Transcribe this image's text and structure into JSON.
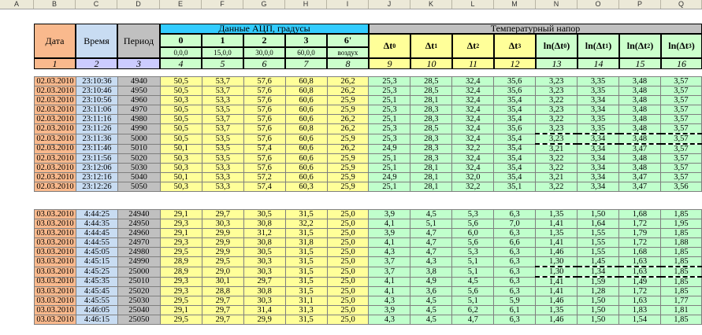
{
  "columns": [
    "A",
    "B",
    "C",
    "D",
    "E",
    "F",
    "G",
    "H",
    "I",
    "J",
    "K",
    "L",
    "M",
    "N",
    "O",
    "P",
    "Q"
  ],
  "header": {
    "date": "Дата",
    "time": "Время",
    "period": "Период",
    "adc_title": "Данные АЦП, градусы",
    "adc_channels": [
      "0",
      "1",
      "2",
      "3",
      "6'"
    ],
    "adc_positions": [
      "0,0,0",
      "15,0,0",
      "30,0,0",
      "60,0,0",
      "воздух"
    ],
    "temp_title": "Температурный напор",
    "dt_labels": [
      [
        "Δt",
        "0"
      ],
      [
        "Δt",
        "1"
      ],
      [
        "Δt",
        "2"
      ],
      [
        "Δt",
        "3"
      ]
    ],
    "ln_labels": [
      [
        "ln(Δt",
        "0",
        ")"
      ],
      [
        "ln(Δt",
        "1",
        ")"
      ],
      [
        "ln(Δt",
        "2",
        ")"
      ],
      [
        "ln(Δt",
        "3",
        ")"
      ]
    ],
    "index_row": [
      "1",
      "2",
      "3",
      "4",
      "5",
      "6",
      "7",
      "8",
      "9",
      "10",
      "11",
      "12",
      "13",
      "14",
      "15",
      "16"
    ]
  },
  "block1": [
    [
      "02.03.2010",
      "23:10:36",
      "4940",
      "50,5",
      "53,7",
      "57,6",
      "60,8",
      "26,2",
      "25,3",
      "28,5",
      "32,4",
      "35,6",
      "3,23",
      "3,35",
      "3,48",
      "3,57"
    ],
    [
      "02.03.2010",
      "23:10:46",
      "4950",
      "50,5",
      "53,7",
      "57,6",
      "60,8",
      "26,2",
      "25,3",
      "28,5",
      "32,4",
      "35,6",
      "3,23",
      "3,35",
      "3,48",
      "3,57"
    ],
    [
      "02.03.2010",
      "23:10:56",
      "4960",
      "50,3",
      "53,3",
      "57,6",
      "60,6",
      "25,9",
      "25,1",
      "28,1",
      "32,4",
      "35,4",
      "3,22",
      "3,34",
      "3,48",
      "3,57"
    ],
    [
      "02.03.2010",
      "23:11:06",
      "4970",
      "50,5",
      "53,5",
      "57,6",
      "60,6",
      "25,9",
      "25,3",
      "28,3",
      "32,4",
      "35,4",
      "3,23",
      "3,34",
      "3,48",
      "3,57"
    ],
    [
      "02.03.2010",
      "23:11:16",
      "4980",
      "50,5",
      "53,7",
      "57,6",
      "60,6",
      "26,2",
      "25,1",
      "28,3",
      "32,4",
      "35,4",
      "3,22",
      "3,35",
      "3,48",
      "3,57"
    ],
    [
      "02.03.2010",
      "23:11:26",
      "4990",
      "50,5",
      "53,7",
      "57,6",
      "60,8",
      "26,2",
      "25,3",
      "28,5",
      "32,4",
      "35,6",
      "3,23",
      "3,35",
      "3,48",
      "3,57"
    ],
    [
      "02.03.2010",
      "23:11:36",
      "5000",
      "50,5",
      "53,5",
      "57,6",
      "60,6",
      "25,9",
      "25,3",
      "28,3",
      "32,4",
      "35,4",
      "3,23",
      "3,34",
      "3,48",
      "3,57"
    ],
    [
      "02.03.2010",
      "23:11:46",
      "5010",
      "50,1",
      "53,5",
      "57,4",
      "60,6",
      "26,2",
      "24,9",
      "28,3",
      "32,2",
      "35,4",
      "3,21",
      "3,34",
      "3,47",
      "3,57"
    ],
    [
      "02.03.2010",
      "23:11:56",
      "5020",
      "50,3",
      "53,5",
      "57,6",
      "60,6",
      "25,9",
      "25,1",
      "28,3",
      "32,4",
      "35,4",
      "3,22",
      "3,34",
      "3,48",
      "3,57"
    ],
    [
      "02.03.2010",
      "23:12:06",
      "5030",
      "50,3",
      "53,3",
      "57,6",
      "60,6",
      "25,9",
      "25,1",
      "28,1",
      "32,4",
      "35,4",
      "3,22",
      "3,34",
      "3,48",
      "3,57"
    ],
    [
      "02.03.2010",
      "23:12:16",
      "5040",
      "50,1",
      "53,3",
      "57,2",
      "60,6",
      "25,9",
      "24,9",
      "28,1",
      "32,0",
      "35,4",
      "3,21",
      "3,34",
      "3,47",
      "3,57"
    ],
    [
      "02.03.2010",
      "23:12:26",
      "5050",
      "50,3",
      "53,3",
      "57,4",
      "60,3",
      "25,9",
      "25,1",
      "28,1",
      "32,2",
      "35,1",
      "3,22",
      "3,34",
      "3,47",
      "3,56"
    ]
  ],
  "block2": [
    [
      "03.03.2010",
      "4:44:25",
      "24940",
      "29,1",
      "29,7",
      "30,5",
      "31,5",
      "25,0",
      "3,9",
      "4,5",
      "5,3",
      "6,3",
      "1,35",
      "1,50",
      "1,68",
      "1,85"
    ],
    [
      "03.03.2010",
      "4:44:35",
      "24950",
      "29,3",
      "30,3",
      "30,8",
      "32,2",
      "25,0",
      "4,1",
      "5,1",
      "5,6",
      "7,0",
      "1,41",
      "1,64",
      "1,72",
      "1,95"
    ],
    [
      "03.03.2010",
      "4:44:45",
      "24960",
      "29,1",
      "29,9",
      "31,2",
      "31,5",
      "25,0",
      "3,9",
      "4,7",
      "6,0",
      "6,3",
      "1,35",
      "1,55",
      "1,79",
      "1,85"
    ],
    [
      "03.03.2010",
      "4:44:55",
      "24970",
      "29,3",
      "29,9",
      "30,8",
      "31,8",
      "25,0",
      "4,1",
      "4,7",
      "5,6",
      "6,6",
      "1,41",
      "1,55",
      "1,72",
      "1,88"
    ],
    [
      "03.03.2010",
      "4:45:05",
      "24980",
      "29,5",
      "29,9",
      "30,5",
      "31,5",
      "25,0",
      "4,3",
      "4,7",
      "5,3",
      "6,3",
      "1,46",
      "1,55",
      "1,68",
      "1,85"
    ],
    [
      "03.03.2010",
      "4:45:15",
      "24990",
      "28,9",
      "29,5",
      "30,3",
      "31,5",
      "25,0",
      "3,7",
      "4,3",
      "5,1",
      "6,3",
      "1,30",
      "1,45",
      "1,63",
      "1,85"
    ],
    [
      "03.03.2010",
      "4:45:25",
      "25000",
      "28,9",
      "29,0",
      "30,3",
      "31,5",
      "25,0",
      "3,7",
      "3,8",
      "5,1",
      "6,3",
      "1,30",
      "1,34",
      "1,63",
      "1,85"
    ],
    [
      "03.03.2010",
      "4:45:35",
      "25010",
      "29,3",
      "30,1",
      "29,7",
      "31,5",
      "25,0",
      "4,1",
      "4,9",
      "4,5",
      "6,3",
      "1,41",
      "1,59",
      "1,49",
      "1,85"
    ],
    [
      "03.03.2010",
      "4:45:45",
      "25020",
      "29,3",
      "28,8",
      "30,8",
      "31,5",
      "25,0",
      "4,1",
      "3,6",
      "5,6",
      "6,3",
      "1,41",
      "1,28",
      "1,72",
      "1,85"
    ],
    [
      "03.03.2010",
      "4:45:55",
      "25030",
      "29,5",
      "29,7",
      "30,3",
      "31,1",
      "25,0",
      "4,3",
      "4,5",
      "5,1",
      "5,9",
      "1,46",
      "1,50",
      "1,63",
      "1,77"
    ],
    [
      "03.03.2010",
      "4:46:05",
      "25040",
      "29,1",
      "29,7",
      "31,4",
      "31,3",
      "25,0",
      "3,9",
      "4,5",
      "6,2",
      "6,1",
      "1,35",
      "1,50",
      "1,83",
      "1,81"
    ],
    [
      "03.03.2010",
      "4:46:15",
      "25050",
      "29,5",
      "29,7",
      "29,9",
      "31,5",
      "25,0",
      "4,3",
      "4,5",
      "4,7",
      "6,3",
      "1,46",
      "1,50",
      "1,54",
      "1,85"
    ]
  ]
}
